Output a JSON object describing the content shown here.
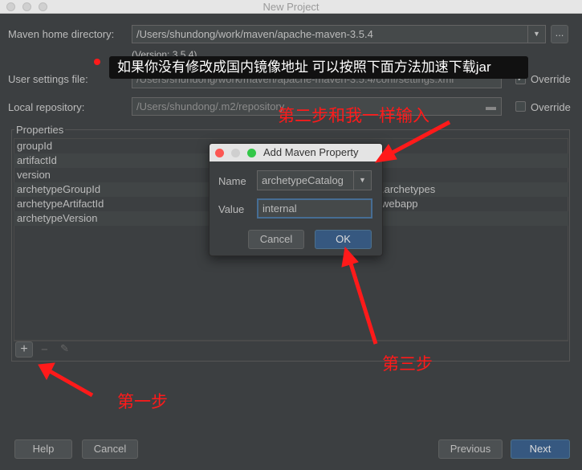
{
  "window": {
    "title": "New Project"
  },
  "form": {
    "maven_home_label": "Maven home directory:",
    "maven_home_value": "/Users/shundong/work/maven/apache-maven-3.5.4",
    "browse_label": "...",
    "version_text": "(Version: 3.5.4)",
    "user_settings_label": "User settings file:",
    "user_settings_value": "/Users/shundong/work/maven/apache-maven-3.5.4/conf/settings.xml",
    "override1_label": "Override",
    "override1_checked": true,
    "local_repo_label": "Local repository:",
    "local_repo_value": "/Users/shundong/.m2/repository",
    "override2_label": "Override",
    "override2_checked": false
  },
  "properties": {
    "title": "Properties",
    "rows": [
      {
        "key": "groupId",
        "value": ""
      },
      {
        "key": "artifactId",
        "value": ""
      },
      {
        "key": "version",
        "value": ""
      },
      {
        "key": "archetypeGroupId",
        "value": ".archetypes"
      },
      {
        "key": "archetypeArtifactId",
        "value": "webapp"
      },
      {
        "key": "archetypeVersion",
        "value": ""
      }
    ]
  },
  "toolbar": {
    "add": "+",
    "remove": "−"
  },
  "dialog": {
    "title": "Add Maven Property",
    "name_label": "Name",
    "name_value": "archetypeCatalog",
    "value_label": "Value",
    "value_value": "internal",
    "cancel": "Cancel",
    "ok": "OK"
  },
  "footer": {
    "help": "Help",
    "cancel": "Cancel",
    "previous": "Previous",
    "next": "Next"
  },
  "annotations": {
    "tooltip": "如果你没有修改成国内镜像地址 可以按照下面方法加速下载jar",
    "step1": "第一步",
    "step2": "第二步和我一样输入",
    "step3": "第三步",
    "color": "#ff1a1a"
  }
}
